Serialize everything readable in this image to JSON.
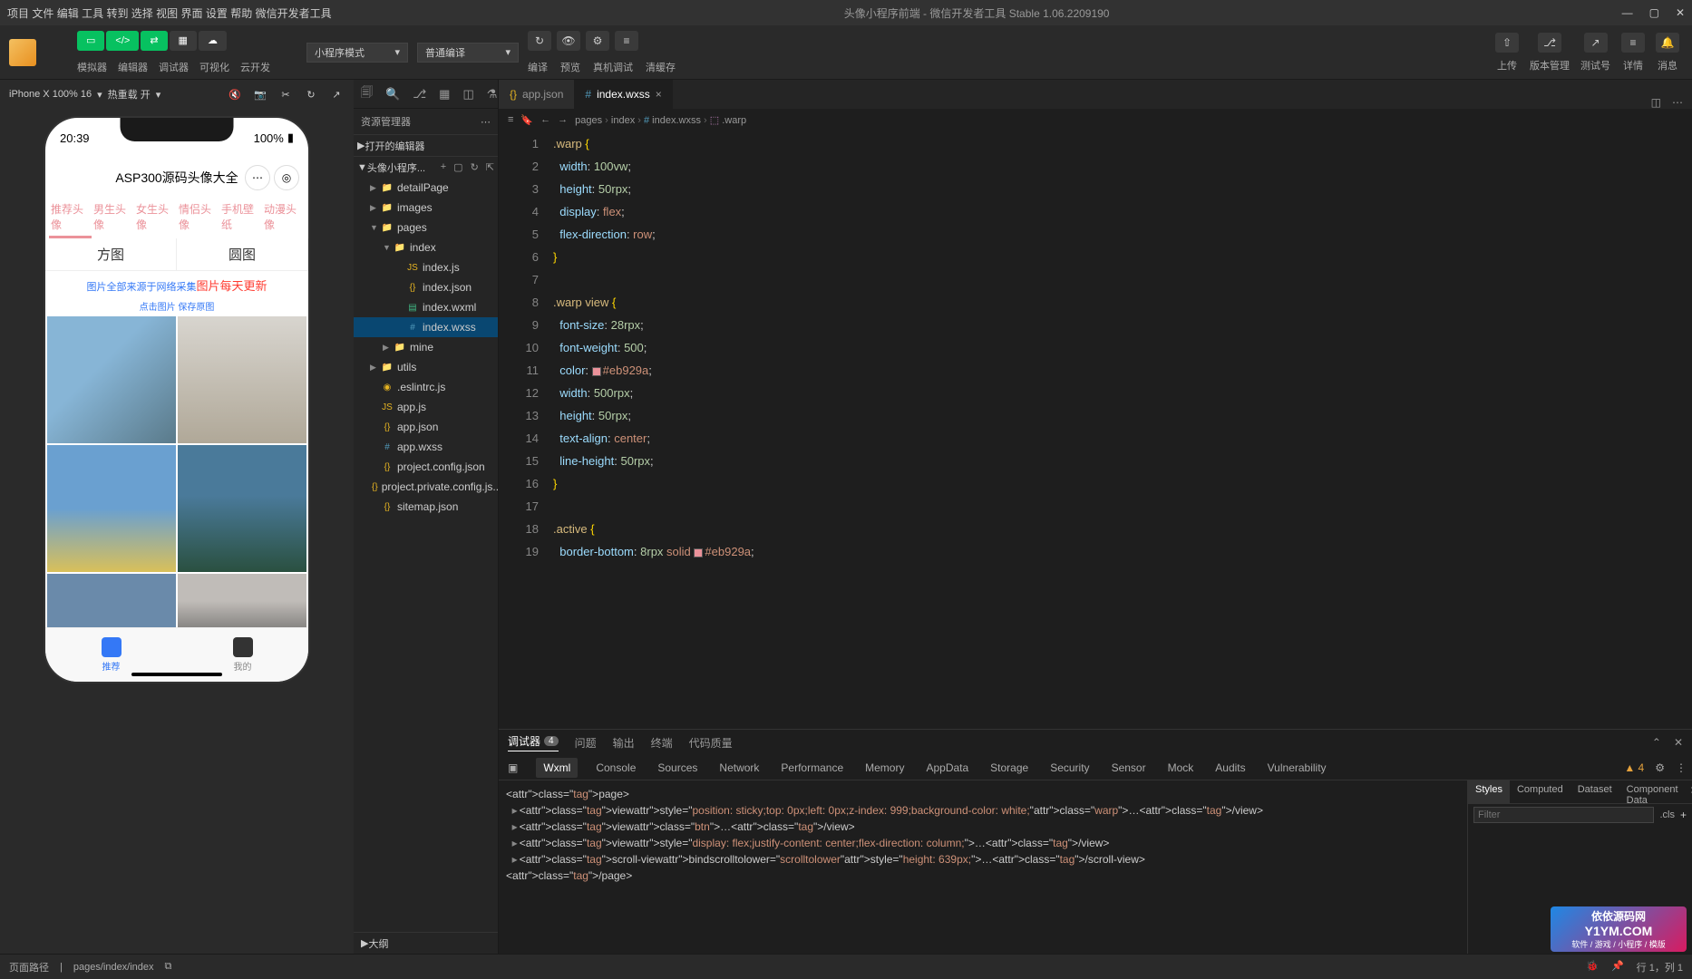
{
  "titlebar": {
    "menus": [
      "项目",
      "文件",
      "编辑",
      "工具",
      "转到",
      "选择",
      "视图",
      "界面",
      "设置",
      "帮助",
      "微信开发者工具"
    ],
    "center": "头像小程序前端 - 微信开发者工具 Stable 1.06.2209190"
  },
  "toolbar": {
    "group1_labels": [
      "模拟器",
      "编辑器",
      "调试器",
      "可视化",
      "云开发"
    ],
    "mode_select": "小程序模式",
    "compile_select": "普通编译",
    "action_labels": [
      "编译",
      "预览",
      "真机调试",
      "清缓存"
    ],
    "right_labels": [
      "上传",
      "版本管理",
      "测试号",
      "详情",
      "消息"
    ]
  },
  "sim": {
    "device": "iPhone X 100% 16",
    "hot_reload": "热重载 开"
  },
  "phone": {
    "time": "20:39",
    "battery": "100%",
    "title": "ASP300源码头像大全",
    "tabs": [
      "推荐头像",
      "男生头像",
      "女生头像",
      "情侣头像",
      "手机壁纸",
      "动漫头像"
    ],
    "shape_tabs": [
      "方图",
      "圆图"
    ],
    "notice_gray": "图片全部来源于网络采集",
    "notice_red": "图片每天更新",
    "sub_notice": "点击图片 保存原图",
    "tab_bar": [
      "推荐",
      "我的"
    ]
  },
  "explorer": {
    "title": "资源管理器",
    "open_editors": "打开的编辑器",
    "project": "头像小程序...",
    "tree": [
      {
        "indent": 1,
        "chev": "▶",
        "icon": "📁",
        "cls": "fi-folder",
        "name": "detailPage"
      },
      {
        "indent": 1,
        "chev": "▶",
        "icon": "📁",
        "cls": "fi-folder",
        "name": "images"
      },
      {
        "indent": 1,
        "chev": "▼",
        "icon": "📁",
        "cls": "fi-folder",
        "name": "pages"
      },
      {
        "indent": 2,
        "chev": "▼",
        "icon": "📁",
        "cls": "fi-folder",
        "name": "index"
      },
      {
        "indent": 3,
        "chev": "",
        "icon": "JS",
        "cls": "fi-js",
        "name": "index.js"
      },
      {
        "indent": 3,
        "chev": "",
        "icon": "{}",
        "cls": "fi-json",
        "name": "index.json"
      },
      {
        "indent": 3,
        "chev": "",
        "icon": "▤",
        "cls": "fi-wxml",
        "name": "index.wxml"
      },
      {
        "indent": 3,
        "chev": "",
        "icon": "#",
        "cls": "fi-wxss",
        "name": "index.wxss",
        "selected": true
      },
      {
        "indent": 2,
        "chev": "▶",
        "icon": "📁",
        "cls": "fi-folder",
        "name": "mine"
      },
      {
        "indent": 1,
        "chev": "▶",
        "icon": "📁",
        "cls": "fi-folder",
        "name": "utils"
      },
      {
        "indent": 1,
        "chev": "",
        "icon": "◉",
        "cls": "fi-js",
        "name": ".eslintrc.js"
      },
      {
        "indent": 1,
        "chev": "",
        "icon": "JS",
        "cls": "fi-js",
        "name": "app.js"
      },
      {
        "indent": 1,
        "chev": "",
        "icon": "{}",
        "cls": "fi-json",
        "name": "app.json"
      },
      {
        "indent": 1,
        "chev": "",
        "icon": "#",
        "cls": "fi-wxss",
        "name": "app.wxss"
      },
      {
        "indent": 1,
        "chev": "",
        "icon": "{}",
        "cls": "fi-json",
        "name": "project.config.json"
      },
      {
        "indent": 1,
        "chev": "",
        "icon": "{}",
        "cls": "fi-json",
        "name": "project.private.config.js..."
      },
      {
        "indent": 1,
        "chev": "",
        "icon": "{}",
        "cls": "fi-json",
        "name": "sitemap.json"
      }
    ],
    "outline": "大纲"
  },
  "editor": {
    "tabs": [
      {
        "icon": "{}",
        "name": "app.json",
        "active": false
      },
      {
        "icon": "#",
        "name": "index.wxss",
        "active": true
      }
    ],
    "breadcrumb": [
      "pages",
      "index",
      "index.wxss",
      ".warp"
    ],
    "code_lines": [
      {
        "n": 1,
        "html": "<span class='sel'>.warp</span> <span class='brace'>{</span>"
      },
      {
        "n": 2,
        "html": "  <span class='prop'>width</span>: <span class='num'>100</span><span class='unit'>vw</span>;"
      },
      {
        "n": 3,
        "html": "  <span class='prop'>height</span>: <span class='num'>50</span><span class='unit'>rpx</span>;"
      },
      {
        "n": 4,
        "html": "  <span class='prop'>display</span>: <span class='val'>flex</span>;"
      },
      {
        "n": 5,
        "html": "  <span class='prop'>flex-direction</span>: <span class='val'>row</span>;"
      },
      {
        "n": 6,
        "html": "<span class='brace'>}</span>"
      },
      {
        "n": 7,
        "html": ""
      },
      {
        "n": 8,
        "html": "<span class='sel'>.warp view</span> <span class='brace'>{</span>"
      },
      {
        "n": 9,
        "html": "  <span class='prop'>font-size</span>: <span class='num'>28</span><span class='unit'>rpx</span>;"
      },
      {
        "n": 10,
        "html": "  <span class='prop'>font-weight</span>: <span class='num'>500</span>;"
      },
      {
        "n": 11,
        "html": "  <span class='prop'>color</span>: <span class='color-swatch'></span><span class='val'>#eb929a</span>;"
      },
      {
        "n": 12,
        "html": "  <span class='prop'>width</span>: <span class='num'>500</span><span class='unit'>rpx</span>;"
      },
      {
        "n": 13,
        "html": "  <span class='prop'>height</span>: <span class='num'>50</span><span class='unit'>rpx</span>;"
      },
      {
        "n": 14,
        "html": "  <span class='prop'>text-align</span>: <span class='val'>center</span>;"
      },
      {
        "n": 15,
        "html": "  <span class='prop'>line-height</span>: <span class='num'>50</span><span class='unit'>rpx</span>;"
      },
      {
        "n": 16,
        "html": "<span class='brace'>}</span>"
      },
      {
        "n": 17,
        "html": ""
      },
      {
        "n": 18,
        "html": "<span class='sel'>.active</span> <span class='brace'>{</span>"
      },
      {
        "n": 19,
        "html": "  <span class='prop'>border-bottom</span>: <span class='num'>8</span><span class='unit'>rpx</span> <span class='val'>solid</span> <span class='color-swatch'></span><span class='val'>#eb929a</span>;"
      }
    ]
  },
  "bottom": {
    "main_tabs": [
      "调试器",
      "问题",
      "输出",
      "终端",
      "代码质量"
    ],
    "badge": "4",
    "devtools": [
      "Wxml",
      "Console",
      "Sources",
      "Network",
      "Performance",
      "Memory",
      "AppData",
      "Storage",
      "Security",
      "Sensor",
      "Mock",
      "Audits",
      "Vulnerability"
    ],
    "warn_count": "4",
    "wxml_lines": [
      "<page>",
      "▸<view style=\"position: sticky;top: 0px;left: 0px;z-index: 999;background-color: white;\" class=\"warp\">…</view>",
      "▸<view class=\"btn\">…</view>",
      "▸<view style=\"display: flex;justify-content: center;flex-direction: column;\">…</view>",
      "▸<scroll-view bindscrolltolower=\"scrolltolower\" style=\"height: 639px;\">…</scroll-view>",
      "</page>"
    ],
    "styles_tabs": [
      "Styles",
      "Computed",
      "Dataset",
      "Component Data"
    ],
    "filter_placeholder": "Filter",
    "cls": ".cls"
  },
  "statusbar": {
    "page_path_label": "页面路径",
    "page_path": "pages/index/index",
    "right": "行 1，列 1"
  },
  "watermark": {
    "l1": "依依源码网",
    "l2": "Y1YM.COM",
    "l3": "软件 / 游戏 / 小程序 / 模版"
  }
}
